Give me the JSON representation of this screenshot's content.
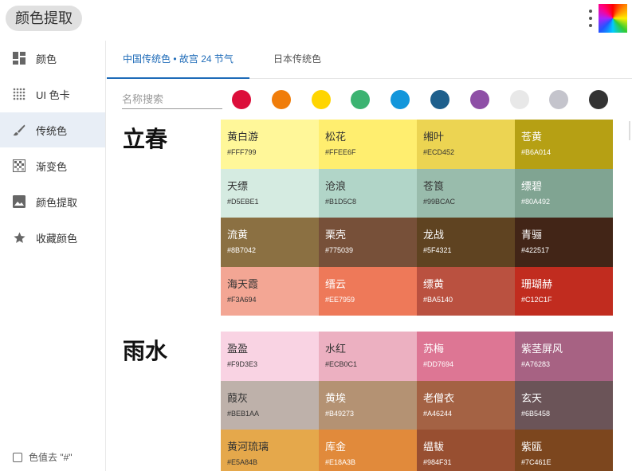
{
  "app": {
    "title": "颜色提取"
  },
  "sidebar": {
    "items": [
      {
        "label": "颜色",
        "icon": "dashboard-icon"
      },
      {
        "label": "UI 色卡",
        "icon": "dot-grid-icon"
      },
      {
        "label": "传统色",
        "icon": "brush-icon"
      },
      {
        "label": "渐变色",
        "icon": "gradient-icon"
      },
      {
        "label": "颜色提取",
        "icon": "image-icon"
      },
      {
        "label": "收藏颜色",
        "icon": "star-icon"
      }
    ],
    "footer_option": "色值去 \"#\""
  },
  "tabs": [
    {
      "label": "中国传统色 • 故宫 24 节气"
    },
    {
      "label": "日本传统色"
    }
  ],
  "search": {
    "placeholder": "名称搜索"
  },
  "filter_colors": [
    "#DC0E3A",
    "#F07D0A",
    "#FFD500",
    "#3CB371",
    "#1296DB",
    "#1E5F8C",
    "#8E4FA6",
    "#E8E8E8",
    "#C4C4CC",
    "#333333"
  ],
  "sections": [
    {
      "title": "立春",
      "colors": [
        {
          "name": "黄白游",
          "hex": "#FFF799"
        },
        {
          "name": "松花",
          "hex": "#FFEE6F"
        },
        {
          "name": "缃叶",
          "hex": "#ECD452"
        },
        {
          "name": "苍黄",
          "hex": "#B6A014"
        },
        {
          "name": "天缥",
          "hex": "#D5EBE1"
        },
        {
          "name": "沧浪",
          "hex": "#B1D5C8"
        },
        {
          "name": "苍筤",
          "hex": "#99BCAC"
        },
        {
          "name": "缥碧",
          "hex": "#80A492"
        },
        {
          "name": "流黄",
          "hex": "#8B7042"
        },
        {
          "name": "栗壳",
          "hex": "#775039"
        },
        {
          "name": "龙战",
          "hex": "#5F4321"
        },
        {
          "name": "青骊",
          "hex": "#422517"
        },
        {
          "name": "海天霞",
          "hex": "#F3A694"
        },
        {
          "name": "缙云",
          "hex": "#EE7959"
        },
        {
          "name": "缥黄",
          "hex": "#BA5140"
        },
        {
          "name": "珊瑚赫",
          "hex": "#C12C1F"
        }
      ]
    },
    {
      "title": "雨水",
      "colors": [
        {
          "name": "盈盈",
          "hex": "#F9D3E3"
        },
        {
          "name": "水红",
          "hex": "#ECB0C1"
        },
        {
          "name": "苏梅",
          "hex": "#DD7694"
        },
        {
          "name": "紫茎屏风",
          "hex": "#A76283"
        },
        {
          "name": "葭灰",
          "hex": "#BEB1AA"
        },
        {
          "name": "黄埃",
          "hex": "#B49273"
        },
        {
          "name": "老僧衣",
          "hex": "#A46244"
        },
        {
          "name": "玄天",
          "hex": "#6B5458"
        },
        {
          "name": "黄河琉璃",
          "hex": "#E5A84B"
        },
        {
          "name": "库金",
          "hex": "#E18A3B"
        },
        {
          "name": "缊韨",
          "hex": "#984F31"
        },
        {
          "name": "紫瓯",
          "hex": "#7C461E"
        }
      ]
    }
  ]
}
